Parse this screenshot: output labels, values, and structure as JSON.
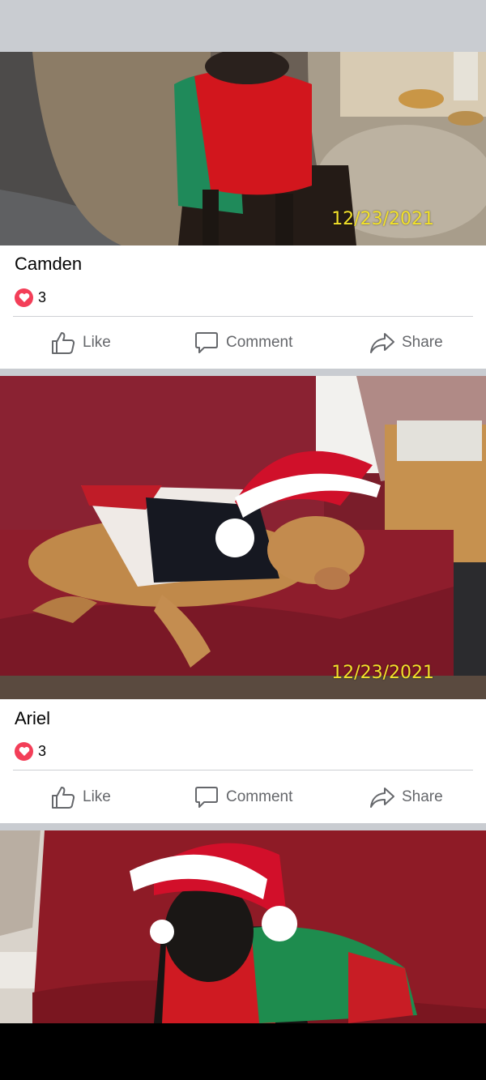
{
  "posts": [
    {
      "timestamp": "12/23/2021",
      "caption": "Camden",
      "reaction_count": "3"
    },
    {
      "timestamp": "12/23/2021",
      "caption": "Ariel",
      "reaction_count": "3"
    },
    {
      "timestamp": "",
      "caption": "",
      "reaction_count": ""
    }
  ],
  "actions": {
    "like": "Like",
    "comment": "Comment",
    "share": "Share"
  },
  "colors": {
    "love_reaction": "#f33e58",
    "action_text": "#65676b",
    "feed_background": "#c9ccd1",
    "timestamp": "#f2e12a"
  },
  "icons": [
    "heart-icon",
    "thumbs-up-icon",
    "comment-icon",
    "share-icon"
  ]
}
